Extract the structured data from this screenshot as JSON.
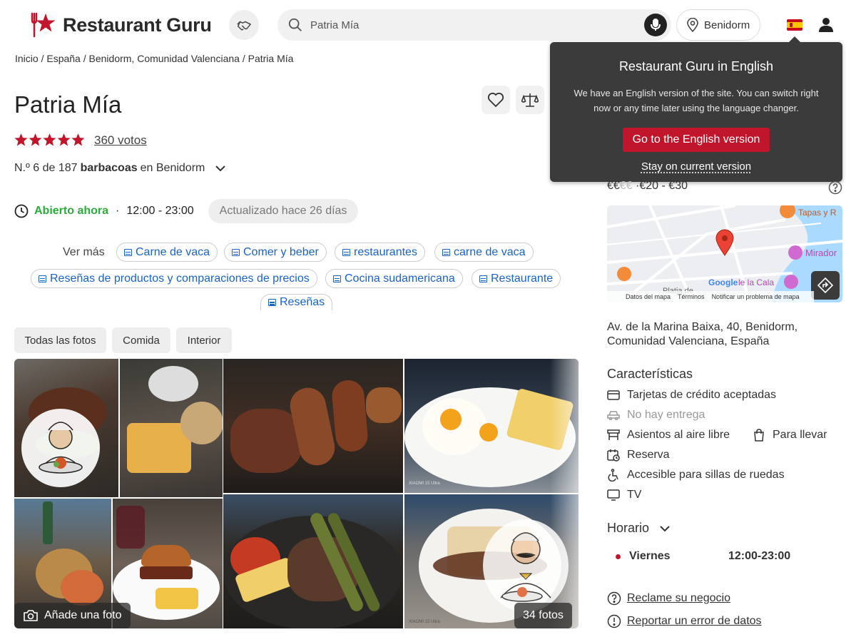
{
  "header": {
    "logo_text": "Restaurant Guru",
    "search_placeholder": "Patria Mía",
    "location": "Benidorm"
  },
  "popup": {
    "title": "Restaurant Guru in English",
    "text": "We have an English version of the site. You can switch right now or any time later using the language changer.",
    "primary": "Go to the English version",
    "secondary": "Stay on current version"
  },
  "breadcrumbs": [
    "Inicio",
    "España",
    "Benidorm, Comunidad Valenciana",
    "Patria Mía"
  ],
  "restaurant": {
    "name": "Patria Mía",
    "votes": "360 votos",
    "rating": 5,
    "rank_prefix": "N.º 6 de 187",
    "rank_category": "barbacoas",
    "rank_suffix": "en Benidorm",
    "open_status": "Abierto ahora",
    "hours_today": "12:00 - 23:00",
    "updated": "Actualizado hace 26 días"
  },
  "see_more": {
    "label": "Ver más",
    "tags": [
      "Carne de vaca",
      "Comer y beber",
      "restaurantes",
      "carne de vaca",
      "Reseñas de productos y comparaciones de precios",
      "Cocina sudamericana",
      "Restaurante",
      "Reseñas"
    ]
  },
  "photo_tabs": [
    "Todas las fotos",
    "Comida",
    "Interior"
  ],
  "photos": {
    "add_photo": "Añade una foto",
    "count": "34 fotos",
    "caption_1": "XIAOMI 15 Ultra",
    "caption_2": "XIAOMI 15 Ultra"
  },
  "right": {
    "price_symbols": "€€",
    "price_faded": "€€",
    "price_range": "·€20 - €30",
    "map": {
      "labels": [
        "Tapas y R",
        "Mirador",
        "le la Cala",
        "Platja de"
      ],
      "footer": [
        "Datos del mapa",
        "Términos",
        "Notificar un problema de mapa"
      ],
      "google": "Google"
    },
    "address": "Av. de la Marina Baixa, 40, Benidorm, Comunidad Valenciana, España",
    "features_title": "Características",
    "features": [
      {
        "label": "Tarjetas de crédito aceptadas",
        "icon": "credit-card-icon",
        "available": true
      },
      {
        "label": "No hay entrega",
        "icon": "delivery-icon",
        "available": false
      },
      {
        "label": "Asientos al aire libre",
        "icon": "outdoor-seating-icon",
        "available": true
      },
      {
        "label": "Para llevar",
        "icon": "takeaway-bag-icon",
        "available": true
      },
      {
        "label": "Reserva",
        "icon": "reservation-icon",
        "available": true
      },
      {
        "label": "Accesible para sillas de ruedas",
        "icon": "wheelchair-icon",
        "available": true
      },
      {
        "label": "TV",
        "icon": "tv-icon",
        "available": true
      }
    ],
    "hours_title": "Horario",
    "hours_day": "Viernes",
    "hours_value": "12:00-23:00",
    "claim": "Reclame su negocio",
    "report": "Reportar un error de datos"
  },
  "colors": {
    "brand_red": "#c0152a",
    "open_green": "#2eaa3e",
    "link_blue": "#1a63c7"
  }
}
